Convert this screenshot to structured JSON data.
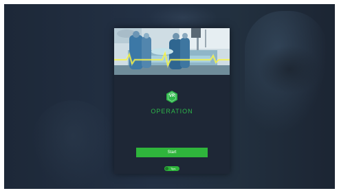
{
  "panel": {
    "hero_image": "surgeons-operating-room-photo",
    "logo": {
      "text": "VR",
      "icon": "hexagon-icon",
      "color": "#2eb84a"
    },
    "title": "OPERATION",
    "start_label": "Start",
    "tips_label": "Tips"
  },
  "colors": {
    "background": "#1f2a3a",
    "panel": "#1e2736",
    "accent": "#2fb53c"
  }
}
